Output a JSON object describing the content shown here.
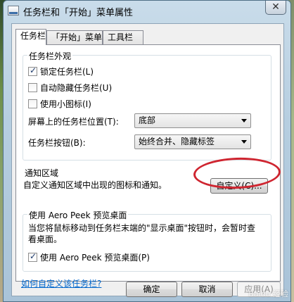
{
  "window": {
    "title": "任务栏和「开始」菜单属性",
    "close_glyph": "✕"
  },
  "tabs": [
    {
      "label": "任务栏",
      "active": true
    },
    {
      "label": "「开始」菜单",
      "active": false
    },
    {
      "label": "工具栏",
      "active": false
    }
  ],
  "appearance": {
    "group_label": "任务栏外观",
    "lock_taskbar": {
      "label": "锁定任务栏(L)",
      "checked": true
    },
    "auto_hide": {
      "label": "自动隐藏任务栏(U)",
      "checked": false
    },
    "small_icons": {
      "label": "使用小图标(I)",
      "checked": false
    },
    "location": {
      "label": "屏幕上的任务栏位置(T):",
      "value": "底部"
    },
    "buttons": {
      "label": "任务栏按钮(B):",
      "value": "始终合并、隐藏标签"
    }
  },
  "notification": {
    "group_label": "通知区域",
    "description": "自定义通知区域中出现的图标和通知。",
    "customize_button": "自定义(C)..."
  },
  "aero_peek": {
    "group_label": "使用 Aero Peek 预览桌面",
    "description": "当您将鼠标移动到任务栏末端的\"显示桌面\"按钮时，会暂时查看桌面。",
    "checkbox": {
      "label": "使用 Aero Peek 预览桌面(P)",
      "checked": true
    }
  },
  "help_link": "如何自定义该任务栏?",
  "footer": {
    "ok": "确定",
    "cancel": "取消",
    "apply": "应用(A)"
  },
  "watermark": "Baidu 经验"
}
